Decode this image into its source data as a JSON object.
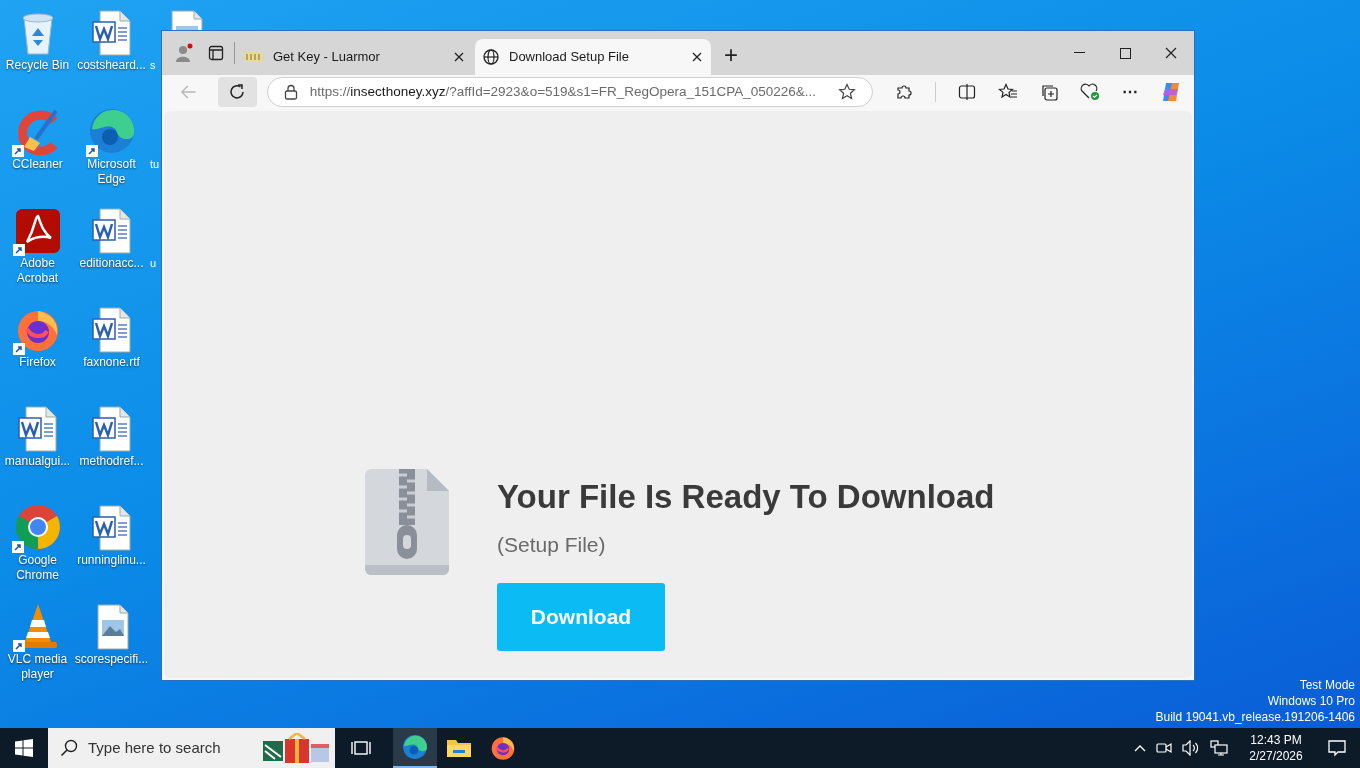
{
  "desktop": {
    "columns": [
      [
        {
          "label": "Recycle Bin",
          "kind": "recycle",
          "shortcut": false
        },
        {
          "label": "CCleaner",
          "kind": "ccleaner",
          "shortcut": true
        },
        {
          "label": "Adobe Acrobat",
          "kind": "acrobat",
          "shortcut": true
        },
        {
          "label": "Firefox",
          "kind": "firefox",
          "shortcut": true
        },
        {
          "label": "manualgui...",
          "kind": "word",
          "shortcut": false
        },
        {
          "label": "Google Chrome",
          "kind": "chrome",
          "shortcut": true
        },
        {
          "label": "VLC media player",
          "kind": "vlc",
          "shortcut": true
        }
      ],
      [
        {
          "label": "costsheard...",
          "kind": "word",
          "shortcut": false
        },
        {
          "label": "Microsoft Edge",
          "kind": "edge",
          "shortcut": true
        },
        {
          "label": "editionacc...",
          "kind": "word",
          "shortcut": false
        },
        {
          "label": "faxnone.rtf",
          "kind": "word",
          "shortcut": false
        },
        {
          "label": "methodref...",
          "kind": "word",
          "shortcut": false
        },
        {
          "label": "runninglinu...",
          "kind": "word",
          "shortcut": false
        },
        {
          "label": "scorespecifi...",
          "kind": "image",
          "shortcut": false
        }
      ],
      [
        {
          "label": "s",
          "kind": "image"
        },
        {
          "label": "tu"
        },
        {
          "label": "u"
        }
      ]
    ]
  },
  "browser": {
    "tabs": [
      {
        "title": "Get Key - Luarmor",
        "kind": "key",
        "selected": false
      },
      {
        "title": "Download Setup File",
        "kind": "globe",
        "selected": true
      }
    ],
    "new_tab": "+",
    "address": {
      "scheme": "https://",
      "host": "insecthoney.xyz",
      "rest": "/?affId=2923&o=519&s1=FR_RegOpera_151CPA_050226&..."
    },
    "back_disabled": true,
    "more": "⋯",
    "page": {
      "heading": "Your File Is Ready To Download",
      "subheading": "(Setup File)",
      "button": "Download"
    }
  },
  "taskbar": {
    "search_placeholder": "Type here to search",
    "apps": [
      {
        "kind": "taskview",
        "active": false
      },
      {
        "kind": "edge",
        "active": true
      },
      {
        "kind": "folder",
        "active": false
      },
      {
        "kind": "firefox",
        "active": false
      }
    ],
    "time": "12:43 PM",
    "date": "2/27/2026"
  },
  "system_notice": [
    "Test Mode",
    "Windows 10 Pro",
    "Build 19041.vb_release.191206-1406"
  ]
}
